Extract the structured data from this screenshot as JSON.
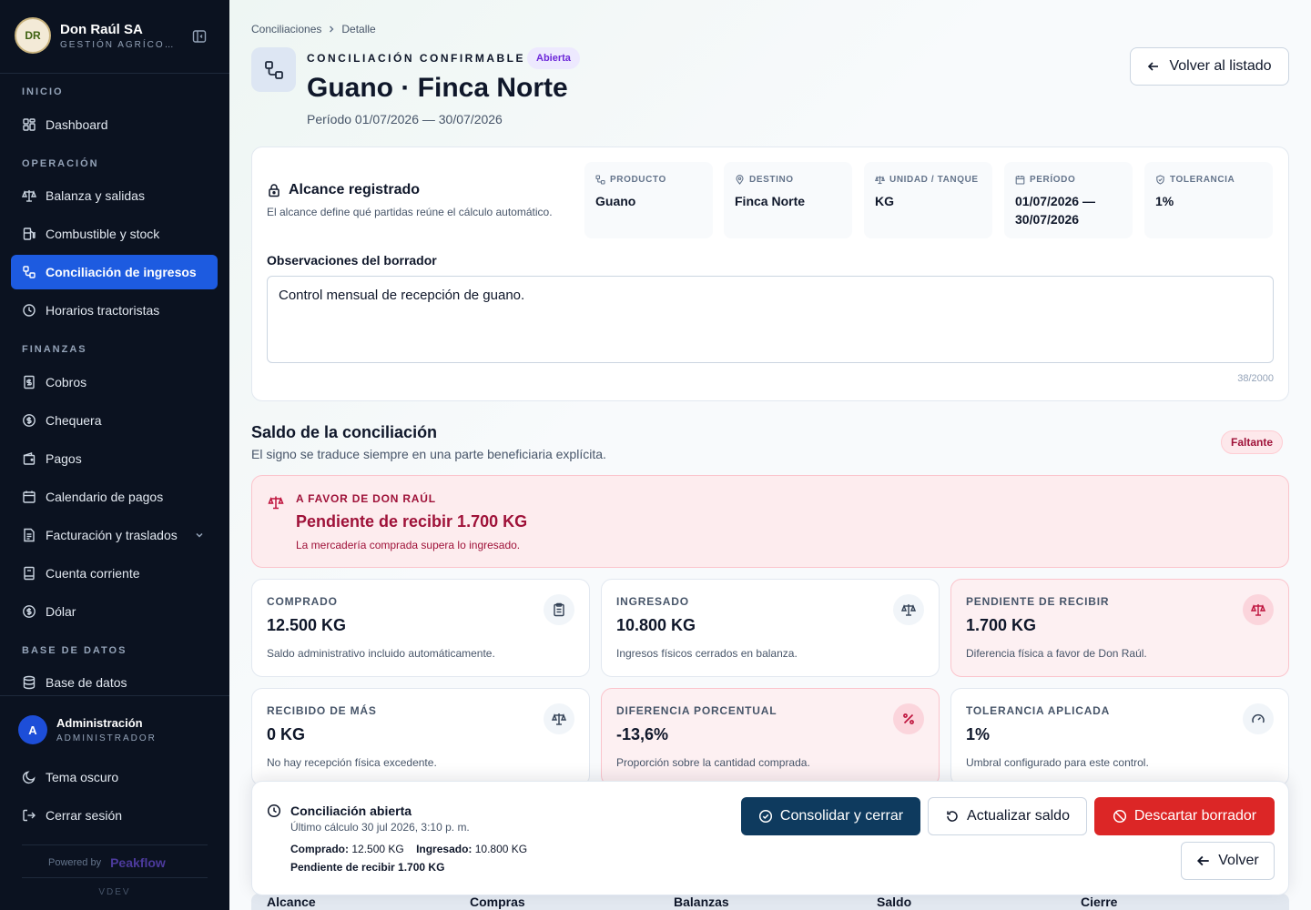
{
  "brand": {
    "name": "Don Raúl SA",
    "subtitle": "GESTIÓN AGRÍCO…",
    "logo_text": "DR"
  },
  "sidebar": {
    "sections": {
      "inicio": "INICIO",
      "operacion": "OPERACIÓN",
      "finanzas": "FINANZAS",
      "base": "BASE DE DATOS"
    },
    "items": [
      {
        "label": "Dashboard",
        "icon": "dashboard-icon"
      },
      {
        "label": "Balanza y salidas",
        "icon": "scale-icon"
      },
      {
        "label": "Combustible y stock",
        "icon": "fuel-icon"
      },
      {
        "label": "Conciliación de ingresos",
        "icon": "reconcile-icon",
        "active": true
      },
      {
        "label": "Horarios tractoristas",
        "icon": "clock-icon"
      },
      {
        "label": "Cobros",
        "icon": "receipt-icon"
      },
      {
        "label": "Chequera",
        "icon": "dollar-circle-icon"
      },
      {
        "label": "Pagos",
        "icon": "wallet-icon"
      },
      {
        "label": "Calendario de pagos",
        "icon": "calendar-icon"
      },
      {
        "label": "Facturación y traslados",
        "icon": "invoice-icon"
      },
      {
        "label": "Cuenta corriente",
        "icon": "ledger-icon"
      },
      {
        "label": "Dólar",
        "icon": "dollar-circle-icon"
      },
      {
        "label": "Base de datos",
        "icon": "database-icon"
      }
    ],
    "user": {
      "initial": "A",
      "name": "Administración",
      "role": "ADMINISTRADOR"
    },
    "theme_label": "Tema oscuro",
    "logout_label": "Cerrar sesión",
    "powered_by": "Powered by",
    "powered_brand": "Peakflow",
    "version": "VDEV"
  },
  "breadcrumb": {
    "parent": "Conciliaciones",
    "current": "Detalle"
  },
  "header": {
    "eyebrow": "CONCILIACIÓN CONFIRMABLE",
    "status_badge": "Abierta",
    "title": "Guano · Finca Norte",
    "period": "Período 01/07/2026 — 30/07/2026",
    "back_button": "Volver al listado"
  },
  "scope": {
    "title": "Alcance registrado",
    "subtitle": "El alcance define qué partidas reúne el cálculo automático.",
    "chips": [
      {
        "label": "PRODUCTO",
        "value": "Guano",
        "icon": "product-icon"
      },
      {
        "label": "DESTINO",
        "value": "Finca Norte",
        "icon": "pin-icon"
      },
      {
        "label": "UNIDAD / TANQUE",
        "value": "KG",
        "icon": "scale-icon"
      },
      {
        "label": "PERÍODO",
        "value": "01/07/2026 — 30/07/2026",
        "icon": "calendar-icon"
      },
      {
        "label": "TOLERANCIA",
        "value": "1%",
        "icon": "shield-icon"
      }
    ],
    "observations_label": "Observaciones del borrador",
    "observations_value": "Control mensual de recepción de guano.",
    "char_count": "38/2000"
  },
  "saldo": {
    "title": "Saldo de la conciliación",
    "subtitle": "El signo se traduce siempre en una parte beneficiaria explícita.",
    "status_badge": "Faltante",
    "alert": {
      "eyebrow": "A FAVOR DE DON RAÚL",
      "title": "Pendiente de recibir 1.700 KG",
      "subtitle": "La mercadería comprada supera lo ingresado."
    },
    "stats": [
      {
        "label": "COMPRADO",
        "value": "12.500 KG",
        "desc": "Saldo administrativo incluido automáticamente.",
        "icon": "clipboard-icon",
        "warn": false
      },
      {
        "label": "INGRESADO",
        "value": "10.800 KG",
        "desc": "Ingresos físicos cerrados en balanza.",
        "icon": "scale-icon",
        "warn": false
      },
      {
        "label": "PENDIENTE DE RECIBIR",
        "value": "1.700 KG",
        "desc": "Diferencia física a favor de Don Raúl.",
        "icon": "scale-icon",
        "warn": true
      },
      {
        "label": "RECIBIDO DE MÁS",
        "value": "0 KG",
        "desc": "No hay recepción física excedente.",
        "icon": "scale-icon",
        "warn": false
      },
      {
        "label": "DIFERENCIA PORCENTUAL",
        "value": "-13,6%",
        "desc": "Proporción sobre la cantidad comprada.",
        "icon": "percent-icon",
        "warn": true
      },
      {
        "label": "TOLERANCIA APLICADA",
        "value": "1%",
        "desc": "Umbral configurado para este control.",
        "icon": "gauge-icon",
        "warn": false
      }
    ]
  },
  "bottom_bar": {
    "title": "Conciliación abierta",
    "subtitle": "Último cálculo 30 jul 2026, 3:10 p. m.",
    "comprado_label": "Comprado:",
    "comprado_value": "12.500 KG",
    "ingresado_label": "Ingresado:",
    "ingresado_value": "10.800 KG",
    "pending_line": "Pendiente de recibir 1.700 KG",
    "consolidate_button": "Consolidar y cerrar",
    "refresh_button": "Actualizar saldo",
    "discard_button": "Descartar borrador",
    "back_button": "Volver"
  },
  "table": {
    "headers": [
      "Alcance",
      "Compras",
      "Balanzas",
      "Saldo",
      "Cierre"
    ]
  }
}
